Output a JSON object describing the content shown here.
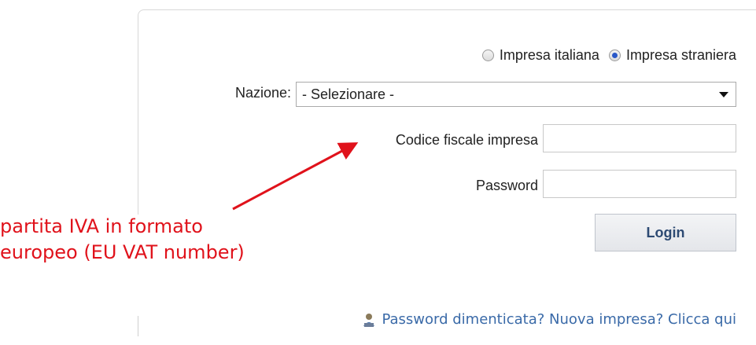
{
  "form": {
    "radio_options": [
      {
        "label": "Impresa italiana",
        "checked": false
      },
      {
        "label": "Impresa straniera",
        "checked": true
      }
    ],
    "nation_label": "Nazione:",
    "nation_selected": "- Selezionare -",
    "tax_code_label": "Codice fiscale impresa",
    "tax_code_value": "",
    "password_label": "Password",
    "password_value": "",
    "login_label": "Login",
    "footer_link": "Password dimenticata? Nuova impresa? Clicca qui",
    "footer_icon": "user-icon"
  },
  "annotation": {
    "line1": "partita IVA in formato",
    "line2": "europeo (EU VAT number)",
    "color": "#e0121b"
  }
}
